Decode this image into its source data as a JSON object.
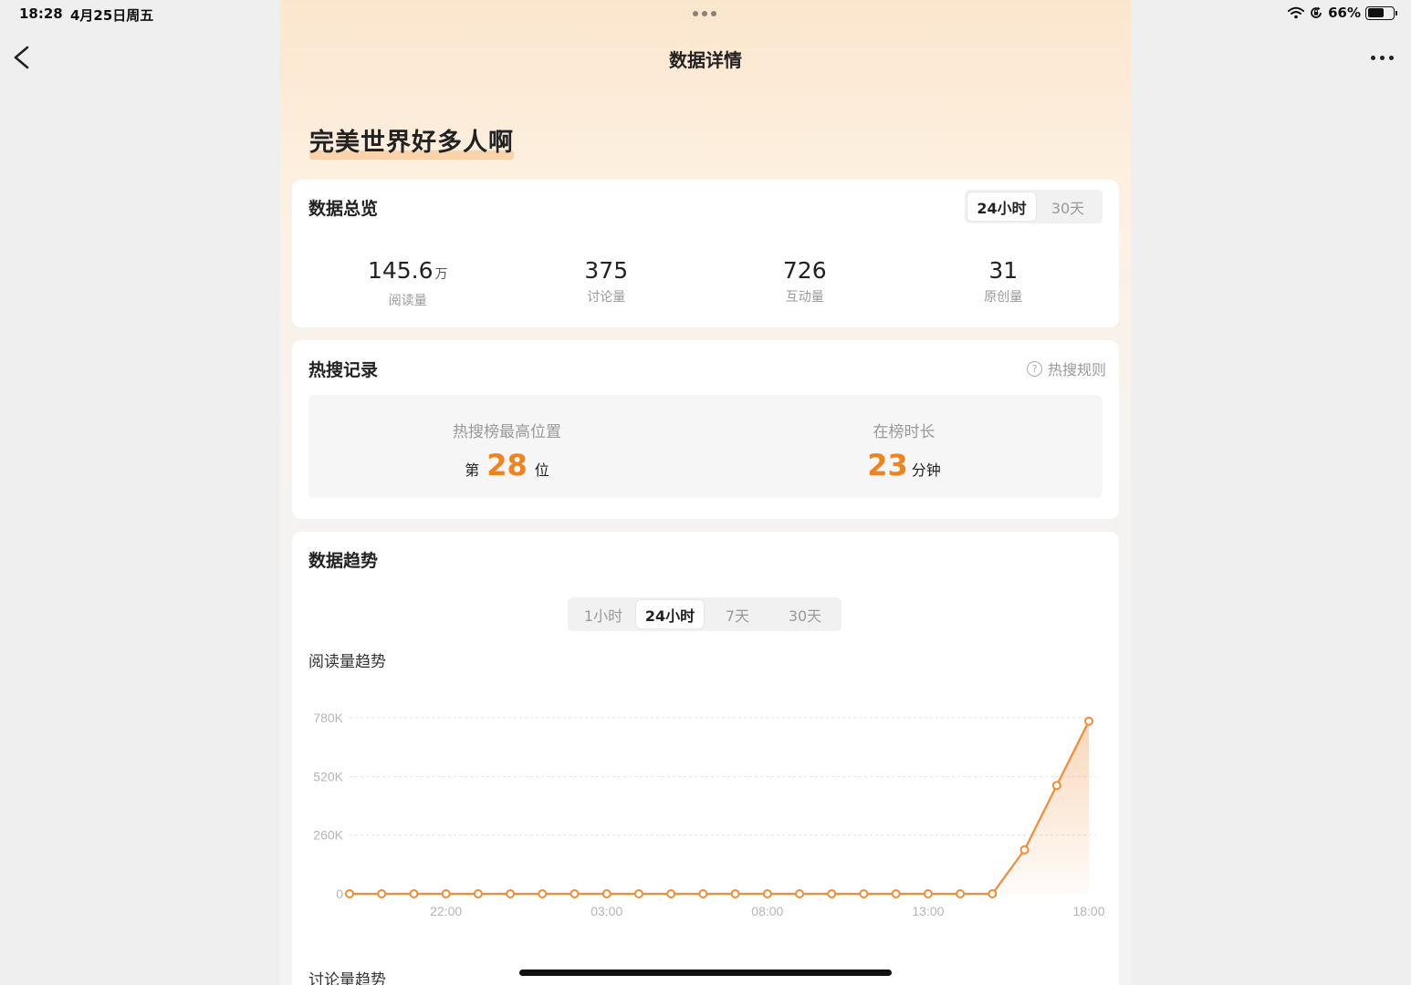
{
  "status_bar": {
    "time": "18:28",
    "date": "4月25日周五",
    "battery": "66%",
    "battery_level": 0.66
  },
  "page": {
    "title": "数据详情",
    "topic": "完美世界好多人啊"
  },
  "overview": {
    "title": "数据总览",
    "tabs": [
      "24小时",
      "30天"
    ],
    "active_tab": 0,
    "stats": [
      {
        "value": "145.6",
        "unit": "万",
        "label": "阅读量"
      },
      {
        "value": "375",
        "unit": "",
        "label": "讨论量"
      },
      {
        "value": "726",
        "unit": "",
        "label": "互动量"
      },
      {
        "value": "31",
        "unit": "",
        "label": "原创量"
      }
    ]
  },
  "hot_search": {
    "title": "热搜记录",
    "rules_label": "热搜规则",
    "highest": {
      "label": "热搜榜最高位置",
      "prefix": "第",
      "value": "28",
      "suffix": "位"
    },
    "duration": {
      "label": "在榜时长",
      "value": "23",
      "suffix": "分钟"
    }
  },
  "trend": {
    "title": "数据趋势",
    "tabs": [
      "1小时",
      "24小时",
      "7天",
      "30天"
    ],
    "active_tab": 1,
    "read_chart_title": "阅读量趋势",
    "next_chart_title": "讨论量趋势"
  },
  "colors": {
    "accent": "#f2821e",
    "line": "#f08c3a"
  },
  "chart_data": {
    "type": "line",
    "title": "阅读量趋势",
    "x_tick_labels": [
      "22:00",
      "03:00",
      "08:00",
      "13:00",
      "18:00"
    ],
    "x_tick_index": [
      3,
      8,
      13,
      18,
      23
    ],
    "y_tick_labels": [
      "0",
      "260K",
      "520K",
      "780K"
    ],
    "y_tick_values": [
      0,
      260000,
      520000,
      780000
    ],
    "ylim": [
      0,
      780000
    ],
    "series": [
      {
        "values": [
          0,
          0,
          0,
          0,
          0,
          0,
          0,
          0,
          0,
          0,
          0,
          0,
          0,
          0,
          0,
          0,
          0,
          0,
          0,
          0,
          0,
          195000,
          480000,
          765000
        ]
      }
    ],
    "grid": true,
    "grid_style": "dashed",
    "area_fill": true
  }
}
